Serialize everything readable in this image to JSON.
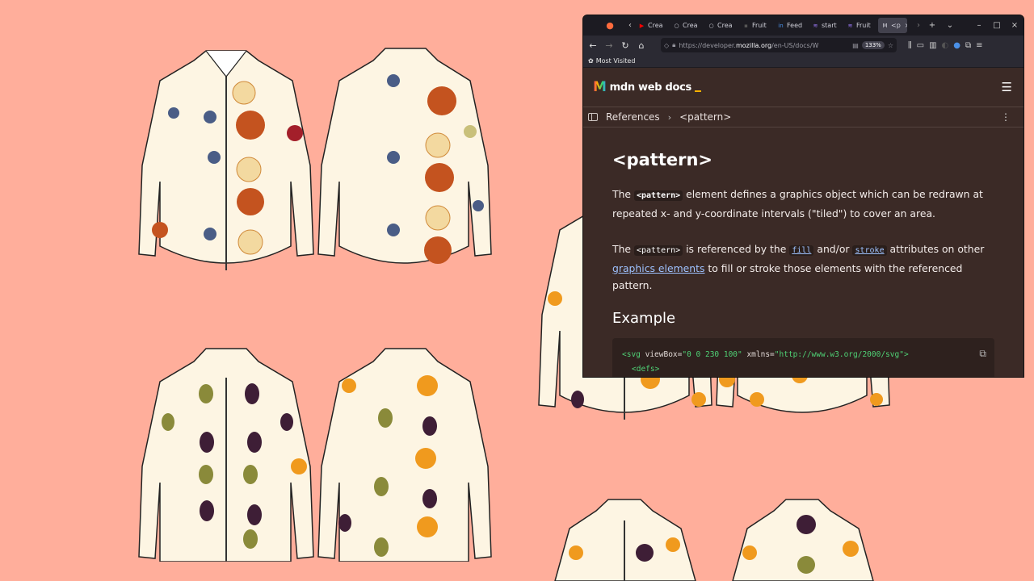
{
  "browser": {
    "tabs": [
      {
        "icon": "youtube-icon",
        "label": "Crea"
      },
      {
        "icon": "circle-icon",
        "label": "Crea"
      },
      {
        "icon": "circle-icon",
        "label": "Crea"
      },
      {
        "icon": "fruit-icon",
        "label": "Fruit"
      },
      {
        "icon": "linkedin-icon",
        "label": "Feed"
      },
      {
        "icon": "stack-icon",
        "label": "start"
      },
      {
        "icon": "stack-icon",
        "label": "Fruit"
      },
      {
        "icon": "mdn-icon",
        "label": "<p"
      }
    ],
    "url_prefix": "https://developer.",
    "url_domain": "mozilla.org",
    "url_rest": "/en-US/docs/W",
    "zoom": "133%",
    "bookmarks_label": "Most Visited"
  },
  "mdn": {
    "logo_text": "mdn web docs",
    "breadcrumb": [
      "References",
      "<pattern>"
    ],
    "title": "<pattern>",
    "p1_before": "The ",
    "p1_code": "<pattern>",
    "p1_after": " element defines a graphics object which can be redrawn at repeated x- and y-coordinate intervals (\"tiled\") to cover an area.",
    "p2_before": "The ",
    "p2_code": "<pattern>",
    "p2_mid1": " is referenced by the ",
    "p2_fill": "fill",
    "p2_mid2": " and/or ",
    "p2_stroke": "stroke",
    "p2_mid3": " attributes on other ",
    "p2_link": "graphics elements",
    "p2_after": " to fill or stroke those elements with the referenced pattern.",
    "example_heading": "Example",
    "code_line1_tag": "<svg",
    "code_line1_attr1": " viewBox=",
    "code_line1_val1": "\"0 0 230 100\"",
    "code_line1_attr2": " xmlns=",
    "code_line1_val2": "\"http://www.w3.org/2000/svg\"",
    "code_line1_end": ">",
    "code_line2": "<defs>"
  },
  "colors": {
    "desktop_bg": "#ffae9b",
    "mdn_bg": "#3b2a26",
    "link": "#9ec2ff",
    "code_green": "#4fd175"
  }
}
